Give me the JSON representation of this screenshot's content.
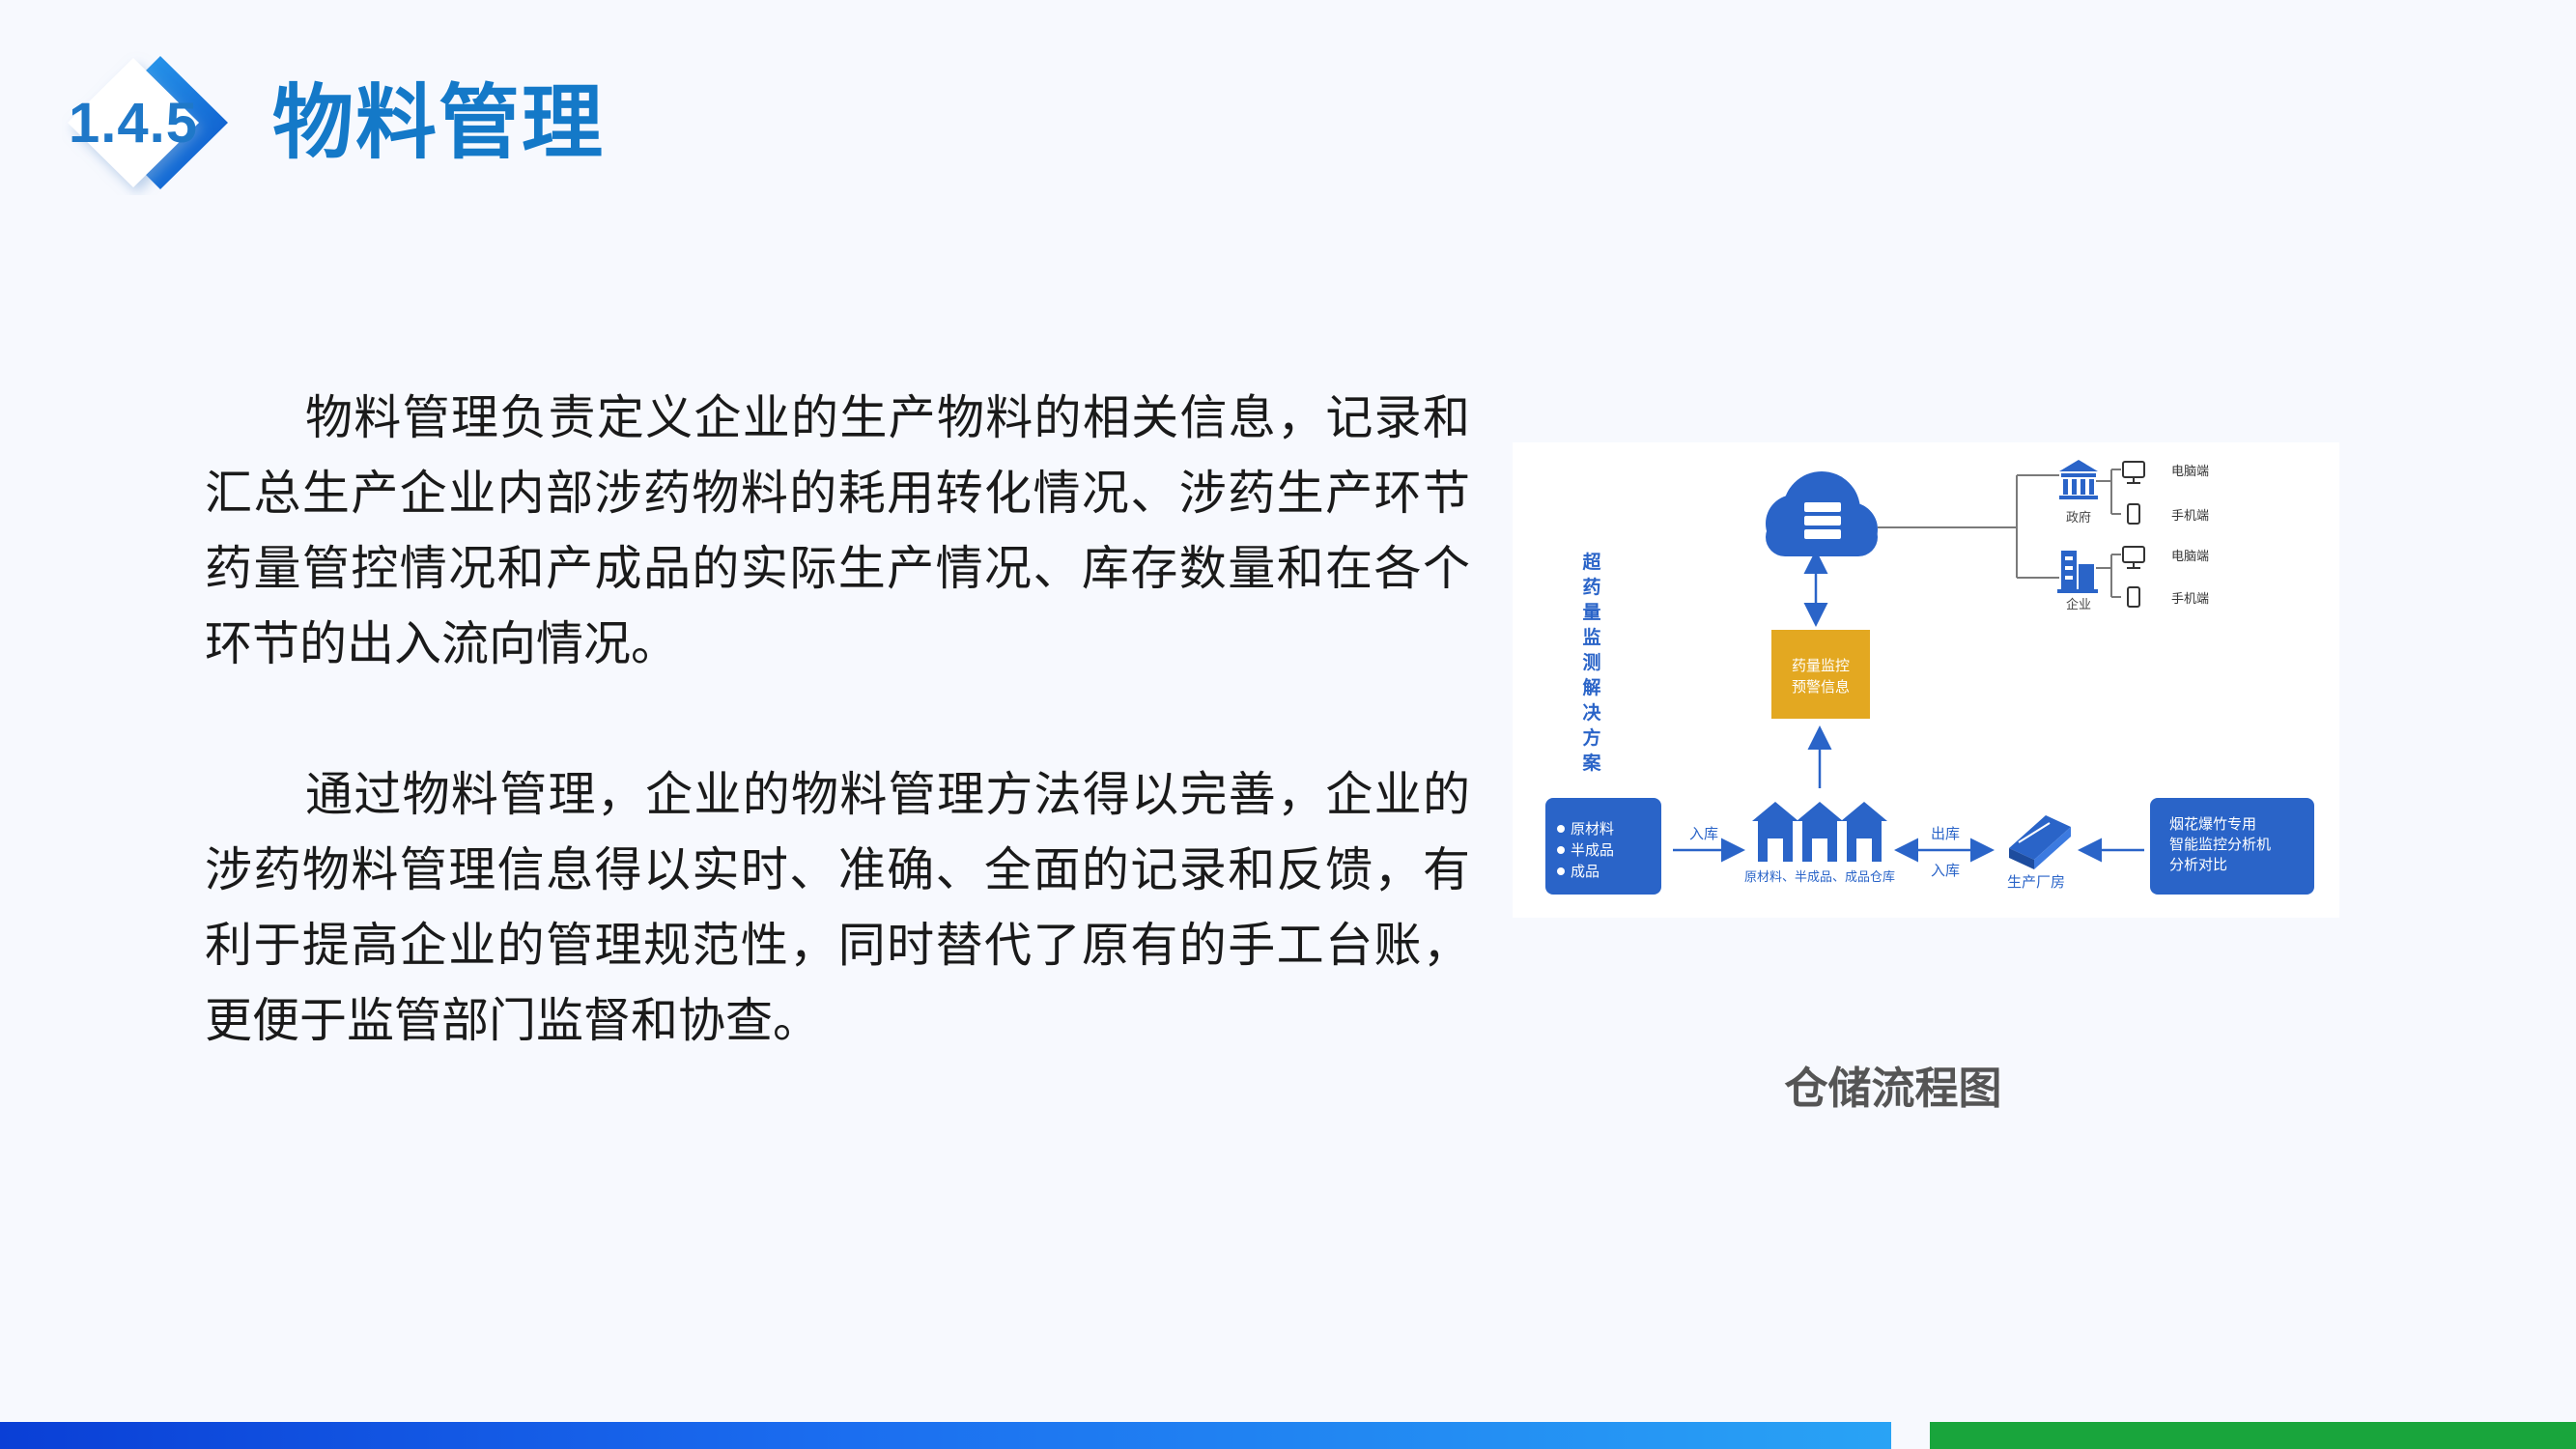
{
  "header": {
    "section_number": "1.4.5",
    "title": "物料管理"
  },
  "content": {
    "paragraphs": [
      "物料管理负责定义企业的生产物料的相关信息，记录和汇总生产企业内部涉药物料的耗用转化情况、涉药生产环节药量管控情况和产成品的实际生产情况、库存数量和在各个环节的出入流向情况。",
      "通过物料管理，企业的物料管理方法得以完善，企业的涉药物料管理信息得以实时、准确、全面的记录和反馈，有利于提高企业的管理规范性，同时替代了原有的手工台账，更便于监管部门监督和协查。"
    ]
  },
  "diagram": {
    "vertical_title": [
      "超",
      "药",
      "量",
      "监",
      "测",
      "解",
      "决",
      "方",
      "案"
    ],
    "alert_box": [
      "药量监控",
      "预警信息"
    ],
    "gov_label": "政府",
    "ent_label": "企业",
    "gov_pc": "电脑端",
    "gov_phone": "手机端",
    "ent_pc": "电脑端",
    "ent_phone": "手机端",
    "materials": [
      "原材料",
      "半成品",
      "成品"
    ],
    "in_label_left": "入库",
    "warehouse_label": "原材料、半成品、成品仓库",
    "out_label": "出库",
    "in_label_right": "入库",
    "factory_label": "生产厂房",
    "analyzer": [
      "烟花爆竹专用",
      "智能监控分析机",
      "分析对比"
    ],
    "colors": {
      "blue": "#2a64c8",
      "gold": "#e3a821",
      "line": "#7a7a7a"
    }
  },
  "caption": "仓储流程图",
  "colors": {
    "title": "#1479c8",
    "bar_blue": "#1b6ef0",
    "bar_green": "#19a53c"
  }
}
